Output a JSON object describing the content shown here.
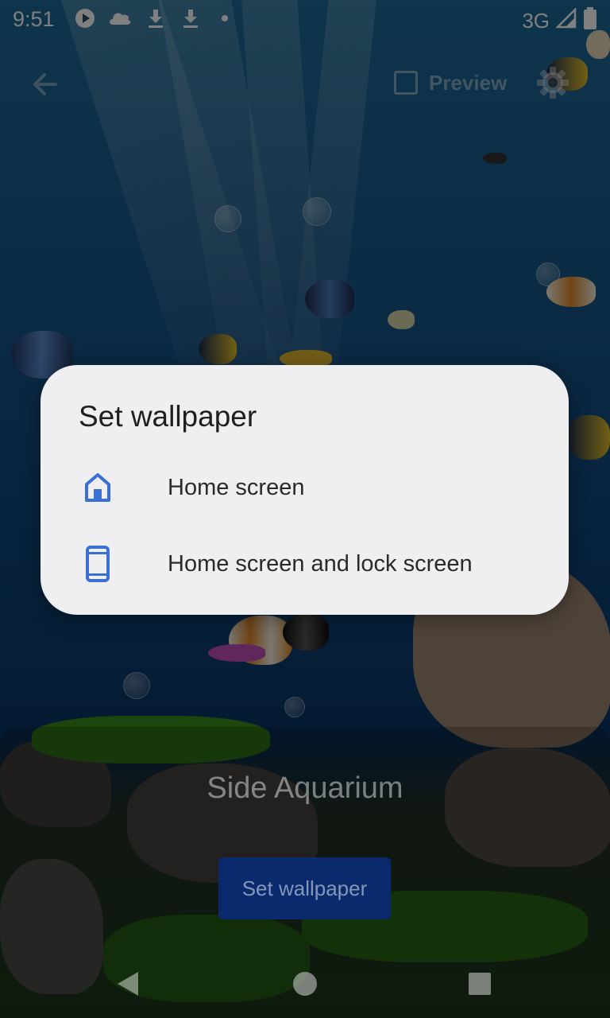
{
  "status_bar": {
    "time": "9:51",
    "network": "3G",
    "left_icons": [
      "play-icon",
      "cloud-icon",
      "download-icon",
      "download-icon",
      "dot-icon"
    ],
    "right_icons": [
      "signal-icon",
      "battery-icon"
    ]
  },
  "app_bar": {
    "preview_label": "Preview",
    "preview_checked": false
  },
  "wallpaper": {
    "name": "Side Aquarium",
    "set_button_label": "Set wallpaper"
  },
  "dialog": {
    "title": "Set wallpaper",
    "options": [
      {
        "label": "Home screen",
        "icon": "home-icon"
      },
      {
        "label": "Home screen and lock screen",
        "icon": "phone-icon"
      }
    ],
    "accent_color": "#3a6fd6"
  },
  "nav_bar": {
    "buttons": [
      "back-triangle-icon",
      "home-circle-icon",
      "recents-square-icon"
    ]
  }
}
